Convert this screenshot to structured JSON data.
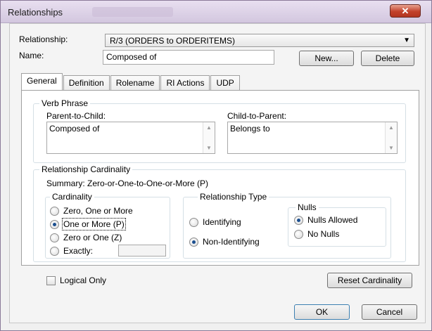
{
  "window": {
    "title": "Relationships",
    "close_glyph": "✕"
  },
  "relationship": {
    "label": "Relationship:",
    "value": "R/3 (ORDERS to ORDERITEMS)"
  },
  "name": {
    "label": "Name:",
    "value": "Composed of"
  },
  "buttons": {
    "new": "New...",
    "delete": "Delete",
    "reset": "Reset Cardinality",
    "ok": "OK",
    "cancel": "Cancel"
  },
  "tabs": [
    "General",
    "Definition",
    "Rolename",
    "RI Actions",
    "UDP"
  ],
  "verb_phrase": {
    "title": "Verb Phrase",
    "parent_to_child": {
      "label": "Parent-to-Child:",
      "value": "Composed of"
    },
    "child_to_parent": {
      "label": "Child-to-Parent:",
      "value": "Belongs to"
    }
  },
  "cardinality_group": {
    "title": "Relationship Cardinality",
    "summary": "Summary:  Zero-or-One-to-One-or-More (P)",
    "cardinality": {
      "title": "Cardinality",
      "options": [
        "Zero, One or More",
        "One or More (P)",
        "Zero or One (Z)",
        "Exactly:"
      ],
      "selected": "One or More (P)",
      "exactly_value": ""
    },
    "type": {
      "title": "Relationship Type",
      "options": [
        "Identifying",
        "Non-Identifying"
      ],
      "selected": "Non-Identifying"
    },
    "nulls": {
      "title": "Nulls",
      "options": [
        "Nulls Allowed",
        "No Nulls"
      ],
      "selected": "Nulls Allowed"
    }
  },
  "logical_only": {
    "label": "Logical Only",
    "checked": false
  }
}
